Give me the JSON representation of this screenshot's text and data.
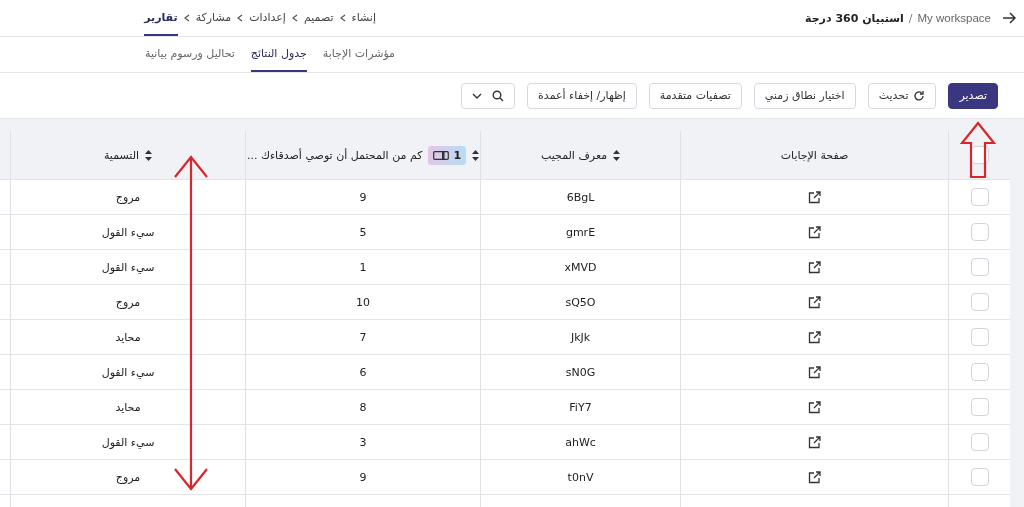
{
  "header": {
    "workspace": "My workspace",
    "separator": "/",
    "survey_title": "استبيان 360 درجة"
  },
  "breadcrumbs": [
    {
      "label": "إنشاء",
      "selected": false
    },
    {
      "label": "تصميم",
      "selected": false
    },
    {
      "label": "إعدادات",
      "selected": false
    },
    {
      "label": "مشاركة",
      "selected": false
    },
    {
      "label": "تقارير",
      "selected": true
    }
  ],
  "tabs": [
    {
      "label": "مؤشرات الإجابة",
      "selected": false
    },
    {
      "label": "جدول النتائج",
      "selected": true
    },
    {
      "label": "تحاليل ورسوم بيانية",
      "selected": false
    }
  ],
  "toolbar": [
    {
      "kind": "primary",
      "label": "تصدير"
    },
    {
      "kind": "refresh",
      "label": "تحديث"
    },
    {
      "kind": "plain",
      "label": "اختيار نطاق زمني"
    },
    {
      "kind": "plain",
      "label": "تصفيات متقدمة"
    },
    {
      "kind": "plain",
      "label": "إظهار/ إخفاء أعمدة"
    },
    {
      "kind": "search"
    }
  ],
  "table": {
    "header_checkbox": {
      "checked": false
    },
    "columns": [
      {
        "kind": "link",
        "label": "صفحة الإجابات",
        "sortable": false
      },
      {
        "kind": "id",
        "label": "معرف المجيب",
        "sortable": true
      },
      {
        "kind": "question",
        "label": "كم من المحتمل أن توصي أصدقاءك ...",
        "badge": "1",
        "sortable": true
      },
      {
        "kind": "label",
        "label": "التسمية",
        "sortable": true
      }
    ],
    "rows": [
      {
        "checked": false,
        "id": "6BgL",
        "score": "9",
        "label": "مروج"
      },
      {
        "checked": false,
        "id": "gmrE",
        "score": "5",
        "label": "سيء القول"
      },
      {
        "checked": false,
        "id": "xMVD",
        "score": "1",
        "label": "سيء القول"
      },
      {
        "checked": false,
        "id": "sQ5O",
        "score": "10",
        "label": "مروج"
      },
      {
        "checked": false,
        "id": "JkJk",
        "score": "7",
        "label": "محايد"
      },
      {
        "checked": false,
        "id": "sN0G",
        "score": "6",
        "label": "سيء القول"
      },
      {
        "checked": false,
        "id": "FiY7",
        "score": "8",
        "label": "محايد"
      },
      {
        "checked": false,
        "id": "ahWc",
        "score": "3",
        "label": "سيء القول"
      },
      {
        "checked": false,
        "id": "t0nV",
        "score": "9",
        "label": "مروج"
      }
    ]
  },
  "annotations": [
    {
      "kind": "up-arrow"
    },
    {
      "kind": "double-arrow"
    }
  ]
}
